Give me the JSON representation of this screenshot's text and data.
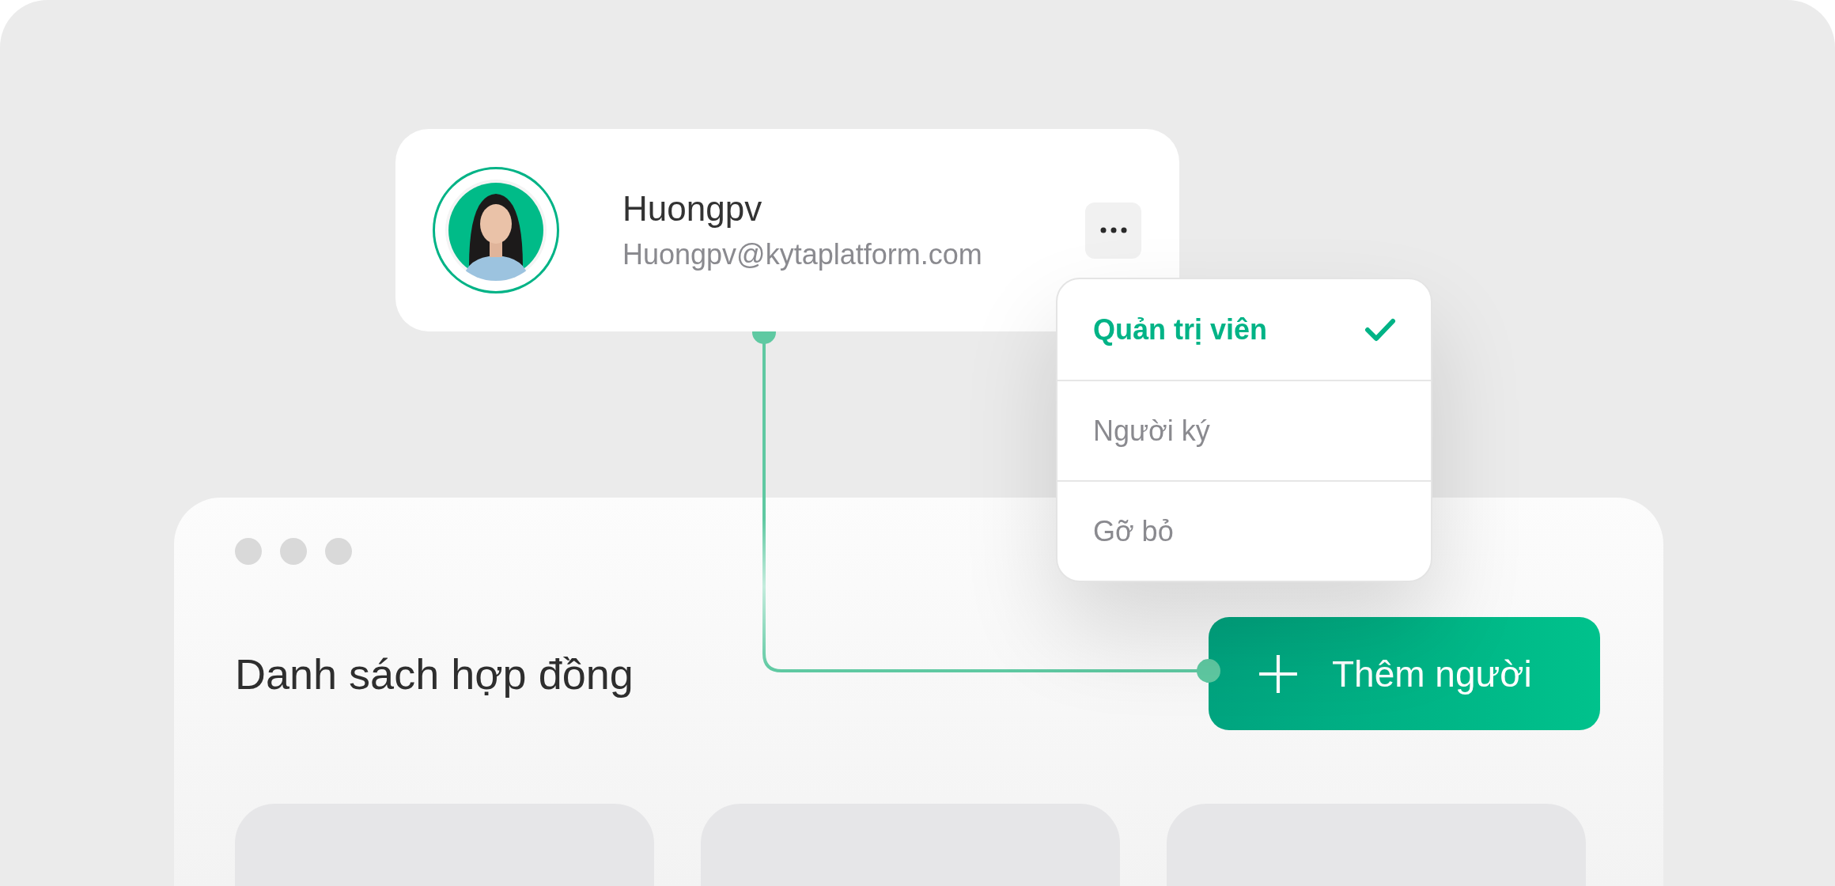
{
  "user": {
    "name": "Huongpv",
    "email": "Huongpv@kytaplatform.com"
  },
  "menu": [
    {
      "label": "Quản trị viên",
      "selected": true
    },
    {
      "label": "Người ký",
      "selected": false
    },
    {
      "label": "Gỡ bỏ",
      "selected": false
    }
  ],
  "window": {
    "title": "Danh sách hợp đồng",
    "add_button": {
      "label": "Thêm người"
    },
    "cards": [
      {
        "kind": "placeholder"
      },
      {
        "kind": "placeholder"
      },
      {
        "kind": "placeholder"
      }
    ]
  }
}
